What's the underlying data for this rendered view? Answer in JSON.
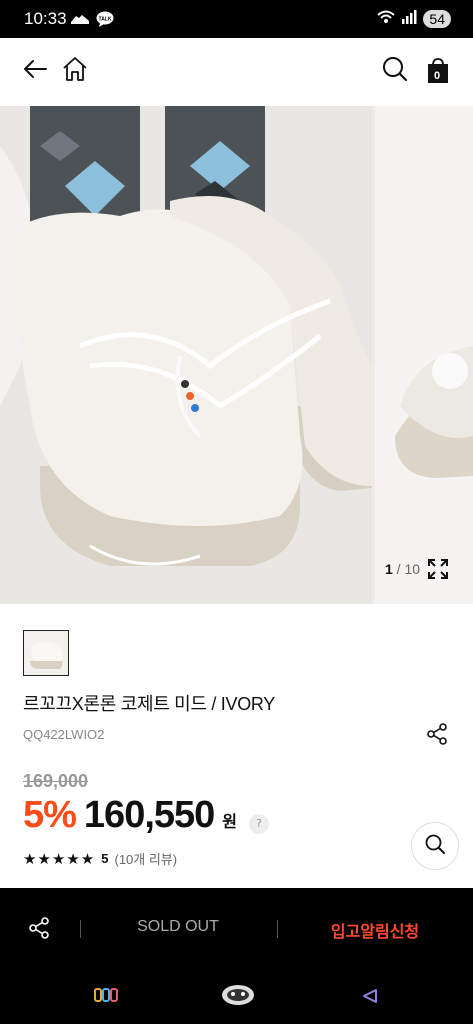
{
  "status_bar": {
    "time": "10:33",
    "left_icons": [
      "sneaker-app-icon",
      "talk-icon"
    ],
    "right_icons": [
      "wifi-icon",
      "signal-icon"
    ],
    "battery": "54"
  },
  "app_bar": {
    "icons": [
      "back-arrow-icon",
      "home-icon",
      "search-icon",
      "shopping-bag-icon"
    ],
    "cart_count": "0"
  },
  "gallery": {
    "current": "1",
    "separator": " / ",
    "total": "10",
    "expand_icon": "expand-icon"
  },
  "product": {
    "name": "르꼬끄X론론 코제트 미드 / IVORY",
    "code": "QQ422LWIO2",
    "original_price": "169,000",
    "discount": "5%",
    "price": "160,550",
    "currency": "원",
    "help_mark": "?",
    "rating_value": "5",
    "review_count": "(10개 리뷰)",
    "stars": 5
  },
  "bottom_bar": {
    "sold_out_label": "SOLD OUT",
    "notify_label": "입고알림신청"
  },
  "colors": {
    "accent": "#ff4b18",
    "notify": "#ff4a2c",
    "bar_bg": "#000000"
  },
  "nav_bar": {
    "icons": [
      "recent-apps-icon",
      "home-button-icon",
      "back-button-icon"
    ]
  }
}
